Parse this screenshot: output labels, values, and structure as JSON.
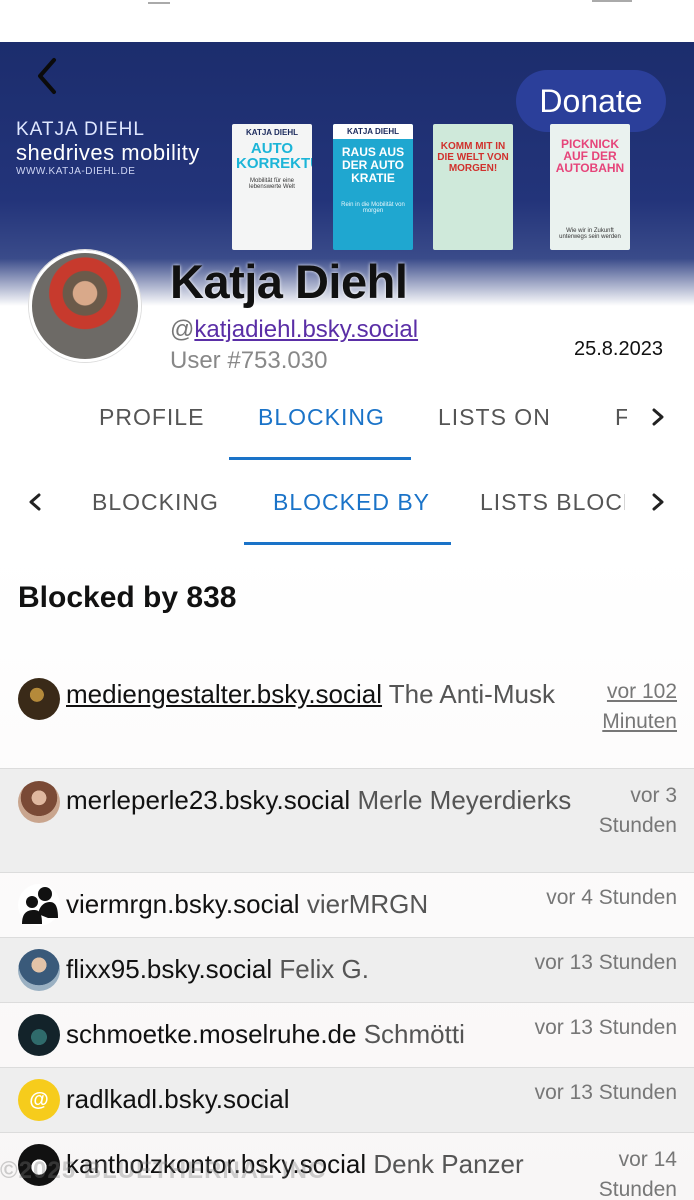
{
  "banner": {
    "brand_name": "KATJA DIEHL",
    "brand_tagline": "shedrives mobility",
    "brand_url": "WWW.KATJA-DIEHL.DE",
    "donate_label": "Donate",
    "books": [
      {
        "author": "KATJA DIEHL",
        "title": "AUTO KORREKTUR",
        "subtitle": "Mobilität für eine lebenswerte Welt"
      },
      {
        "author": "KATJA DIEHL",
        "title": "RAUS AUS DER AUTO KRATIE",
        "subtitle": "Rein in die Mobilität von morgen"
      },
      {
        "author": "",
        "title": "KOMM MIT IN DIE WELT VON MORGEN!",
        "subtitle": ""
      },
      {
        "author": "",
        "title": "PICKNICK AUF DER AUTOBAHN",
        "subtitle": "Wie wir in Zukunft unterwegs sein werden"
      }
    ]
  },
  "profile": {
    "name": "Katja Diehl",
    "handle_prefix": "@",
    "handle": "katjadiehl.bsky.social",
    "user_number": "User #753.030",
    "joined": "25.8.2023"
  },
  "tabs_primary": [
    {
      "label": "PROFILE"
    },
    {
      "label": "BLOCKING"
    },
    {
      "label": "LISTS ON"
    },
    {
      "label": "F"
    }
  ],
  "tabs_secondary": [
    {
      "label": "BLOCKING"
    },
    {
      "label": "BLOCKED BY"
    },
    {
      "label": "LISTS BLOCKING"
    }
  ],
  "section_title": "Blocked by 838",
  "rows": [
    {
      "handle": "mediengestalter.bsky.social",
      "display": "The Anti-Musk",
      "time_line1": "vor 102",
      "time_line2": "Minuten"
    },
    {
      "handle": "merleperle23.bsky.social",
      "display": "Merle Meyerdierks",
      "time_line1": "vor 3",
      "time_line2": "Stunden"
    },
    {
      "handle": "viermrgn.bsky.social",
      "display": "vierMRGN",
      "time_line1": "vor 4 Stunden",
      "time_line2": ""
    },
    {
      "handle": "flixx95.bsky.social",
      "display": "Felix G.",
      "time_line1": "vor 13 Stunden",
      "time_line2": ""
    },
    {
      "handle": "schmoetke.moselruhe.de",
      "display": "Schmötti",
      "time_line1": "vor 13 Stunden",
      "time_line2": ""
    },
    {
      "handle": "radlkadl.bsky.social",
      "display": "",
      "time_line1": "vor 13 Stunden",
      "time_line2": ""
    },
    {
      "handle": "kantholzkontor.bsky.social",
      "display": "Denk Panzer",
      "time_line1": "vor 14",
      "time_line2": "Stunden"
    }
  ],
  "watermark": "©2025 BLUETHERNAL INC"
}
